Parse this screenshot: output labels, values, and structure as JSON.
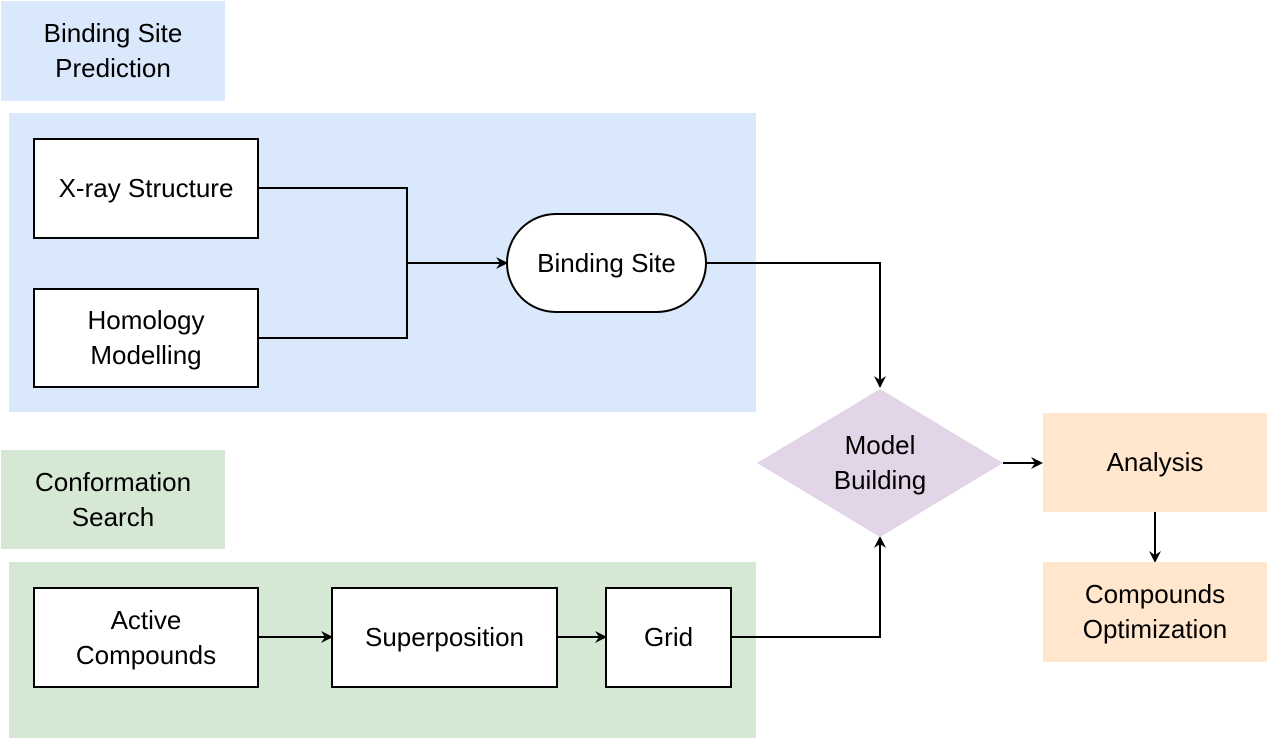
{
  "groups": {
    "binding_site_prediction": {
      "title": "Binding Site\nPrediction",
      "color": "#dae8fc"
    },
    "conformation_search": {
      "title": "Conformation\nSearch",
      "color": "#d5e8d4"
    }
  },
  "nodes": {
    "xray_structure": "X-ray Structure",
    "homology_modelling": "Homology\nModelling",
    "binding_site": "Binding Site",
    "active_compounds": "Active\nCompounds",
    "superposition": "Superposition",
    "grid": "Grid",
    "model_building": "Model\nBuilding",
    "analysis": "Analysis",
    "compounds_optimization": "Compounds\nOptimization"
  },
  "colors": {
    "decision_fill": "#e1d5e7",
    "output_fill": "#ffe6cc",
    "edge": "#000000"
  },
  "edges": [
    [
      "X-ray Structure",
      "Binding Site"
    ],
    [
      "Homology Modelling",
      "Binding Site"
    ],
    [
      "Binding Site",
      "Model Building"
    ],
    [
      "Active Compounds",
      "Superposition"
    ],
    [
      "Superposition",
      "Grid"
    ],
    [
      "Grid",
      "Model Building"
    ],
    [
      "Model Building",
      "Analysis"
    ],
    [
      "Analysis",
      "Compounds Optimization"
    ]
  ]
}
